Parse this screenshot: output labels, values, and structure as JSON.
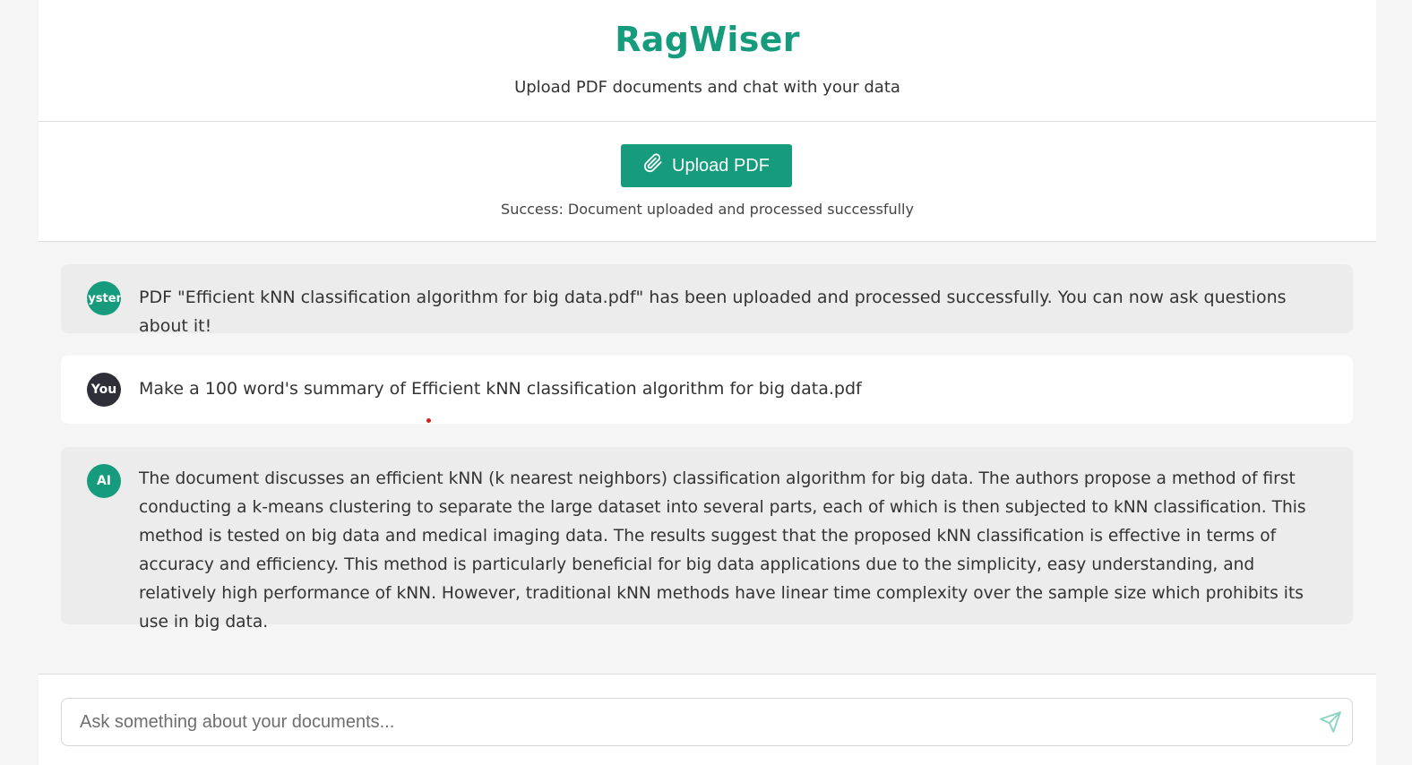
{
  "header": {
    "title": "RagWiser",
    "subtitle": "Upload PDF documents and chat with your data"
  },
  "upload": {
    "button_label": "Upload PDF",
    "button_icon": "paperclip-icon",
    "status": "Success: Document uploaded and processed successfully"
  },
  "messages": [
    {
      "role": "system",
      "avatar_label": "System",
      "text": "PDF \"Efficient kNN classification algorithm for big data.pdf\" has been uploaded and processed successfully. You can now ask questions about it!"
    },
    {
      "role": "user",
      "avatar_label": "You",
      "text": "Make a 100 word's summary of Efficient kNN classification algorithm for big data.pdf"
    },
    {
      "role": "ai",
      "avatar_label": "AI",
      "text": "The document discusses an efficient kNN (k nearest neighbors) classification algorithm for big data. The authors propose a method of first conducting a k-means clustering to separate the large dataset into several parts, each of which is then subjected to kNN classification. This method is tested on big data and medical imaging data. The results suggest that the proposed kNN classification is effective in terms of accuracy and efficiency. This method is particularly beneficial for big data applications due to the simplicity, easy understanding, and relatively high performance of kNN. However, traditional kNN methods have linear time complexity over the sample size which prohibits its use in big data."
    }
  ],
  "chat_input": {
    "value": "",
    "placeholder": "Ask something about your documents...",
    "send_icon": "send-icon"
  },
  "colors": {
    "accent": "#169c7d",
    "user_avatar": "#2f2f3a",
    "background": "#f5f5f5"
  }
}
